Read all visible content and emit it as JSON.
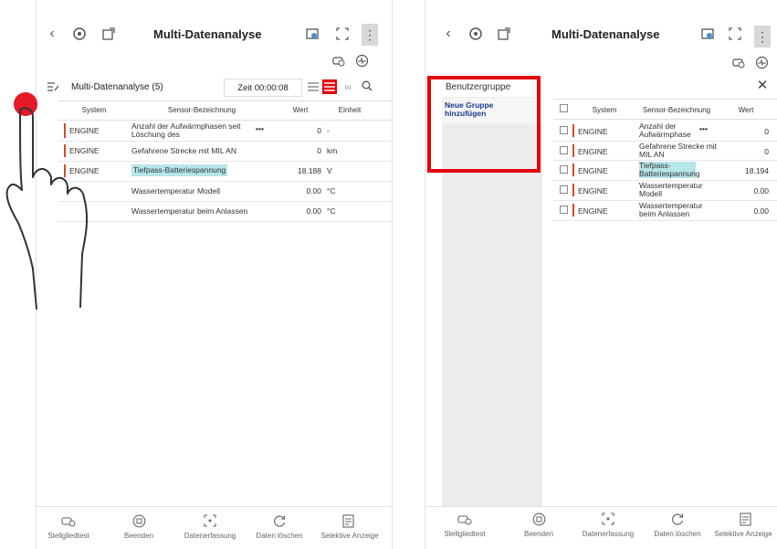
{
  "left": {
    "header_title": "Multi-Datenanalyse",
    "list_title": "Multi-Datenanalyse (5)",
    "time_label": "Zeit 00:00:08",
    "columns": {
      "system": "System",
      "sensor": "Sensor-Bezeichnung",
      "wert": "Wert",
      "einheit": "Einheit"
    },
    "rows": [
      {
        "system": "ENGINE",
        "sensor": "Anzahl der Aufwärmphasen seit Löschung des",
        "more": "•••",
        "wert": "0",
        "einheit": "-"
      },
      {
        "system": "ENGINE",
        "sensor": "Gefahrene Strecke mit MIL AN",
        "wert": "0",
        "einheit": "km"
      },
      {
        "system": "ENGINE",
        "sensor": "Tiefpass-Batteriespannung",
        "wert": "18.188",
        "einheit": "V"
      },
      {
        "system": "",
        "sensor": "Wassertemperatur Modell",
        "wert": "0.00",
        "einheit": "°C"
      },
      {
        "system": "",
        "sensor": "Wassertemperatur beim Anlassen",
        "wert": "0.00",
        "einheit": "°C"
      }
    ],
    "bottom": [
      "Stellgliedtest",
      "Beenden",
      "Datenerfassung",
      "Daten löschen",
      "Selektive Anzeige"
    ]
  },
  "right": {
    "header_title": "Multi-Datenanalyse",
    "group_title": "Benutzergruppe",
    "add_group": "Neue Gruppe hinzufügen",
    "columns": {
      "system": "System",
      "sensor": "Sensor-Bezeichnung",
      "wert": "Wert"
    },
    "rows": [
      {
        "system": "ENGINE",
        "sensor": "Anzahl der Aufwärmphase",
        "more": "•••",
        "wert": "0"
      },
      {
        "system": "ENGINE",
        "sensor": "Gefahrene Strecke mit MIL AN",
        "wert": "0"
      },
      {
        "system": "ENGINE",
        "sensor": "Tiefpass-Batteriespannung",
        "wert": "18.194"
      },
      {
        "system": "ENGINE",
        "sensor": "Wassertemperatur Modell",
        "wert": "0.00"
      },
      {
        "system": "ENGINE",
        "sensor": "Wassertemperatur beim Anlassen",
        "wert": "0.00"
      }
    ],
    "bottom": [
      "Stellgliedtest",
      "Beenden",
      "Datenerfassung",
      "Daten löschen",
      "Selektive Anzeige"
    ]
  },
  "colors": {
    "accent_red": "#e3000f",
    "system_bar": "#d9482f",
    "highlight": "#b6e5ea",
    "panel_gray": "#ececec",
    "selected_text": "#1a3a8a"
  }
}
